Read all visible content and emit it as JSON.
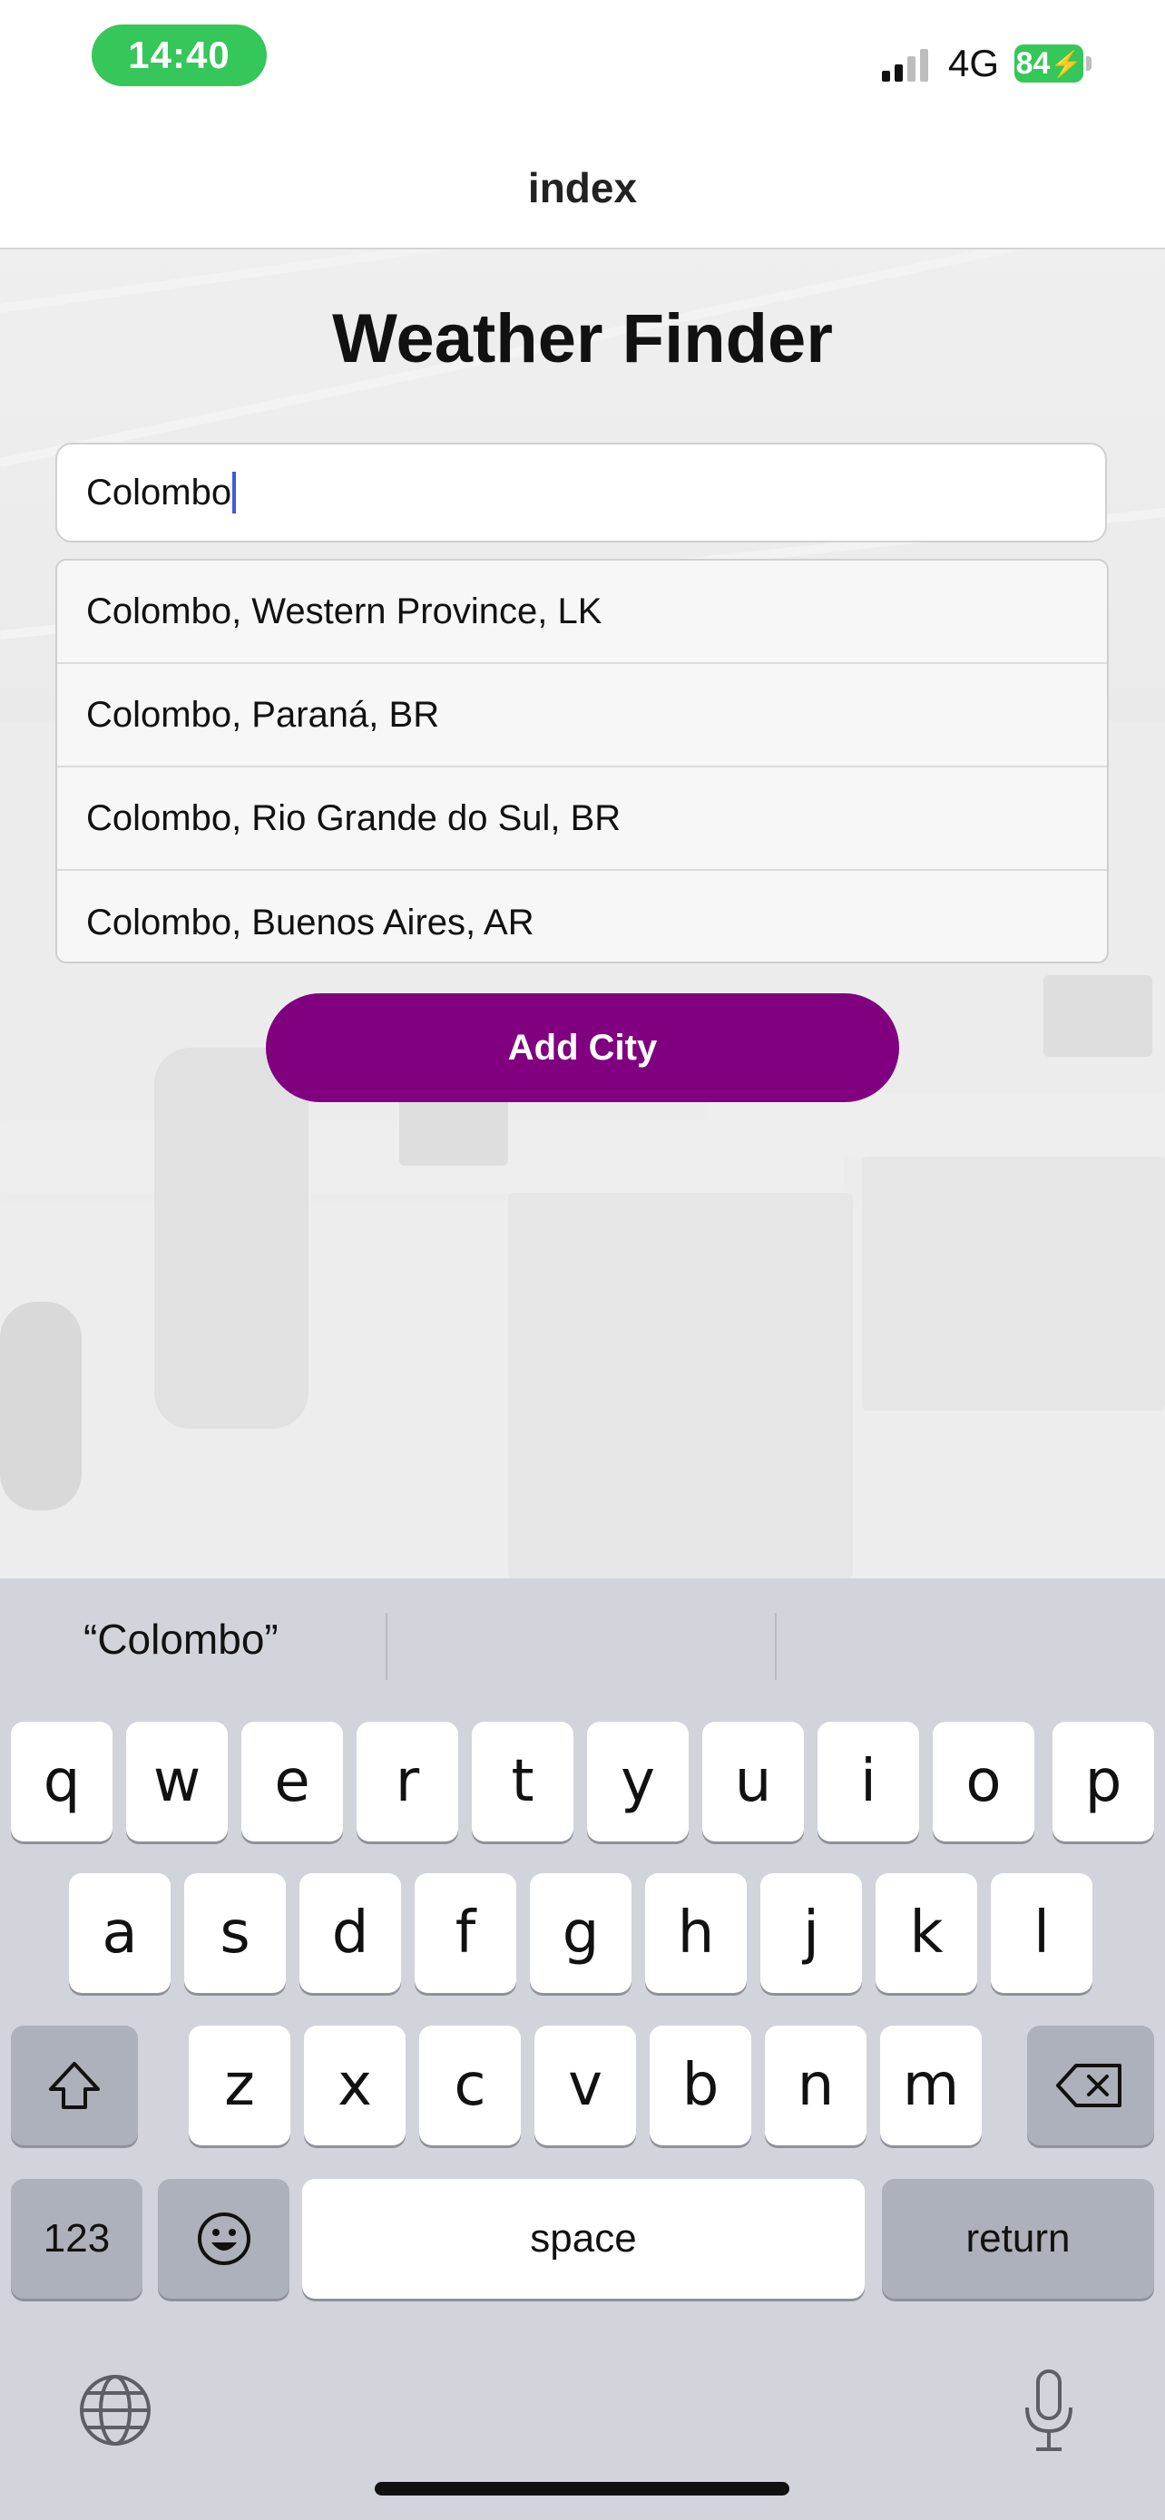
{
  "status_bar": {
    "time": "14:40",
    "network": "4G",
    "battery": "84",
    "colors": {
      "time_pill": "#35c759",
      "battery": "#35c759"
    }
  },
  "navbar": {
    "title": "index"
  },
  "main": {
    "heading": "Weather Finder",
    "search": {
      "value": "Colombo"
    },
    "suggestions": [
      "Colombo, Western Province, LK",
      "Colombo, Paraná, BR",
      "Colombo, Rio Grande do Sul, BR",
      "Colombo, Buenos Aires, AR"
    ],
    "add_button": {
      "label": "Add City",
      "color": "#800080"
    }
  },
  "keyboard": {
    "prediction": "“Colombo”",
    "row1": [
      "q",
      "w",
      "e",
      "r",
      "t",
      "y",
      "u",
      "i",
      "o",
      "p"
    ],
    "row2": [
      "a",
      "s",
      "d",
      "f",
      "g",
      "h",
      "j",
      "k",
      "l"
    ],
    "row3": [
      "z",
      "x",
      "c",
      "v",
      "b",
      "n",
      "m"
    ],
    "numbers_key": "123",
    "space_key": "space",
    "return_key": "return",
    "icons": [
      "shift-icon",
      "backspace-icon",
      "emoji-icon",
      "globe-icon",
      "microphone-icon"
    ]
  }
}
